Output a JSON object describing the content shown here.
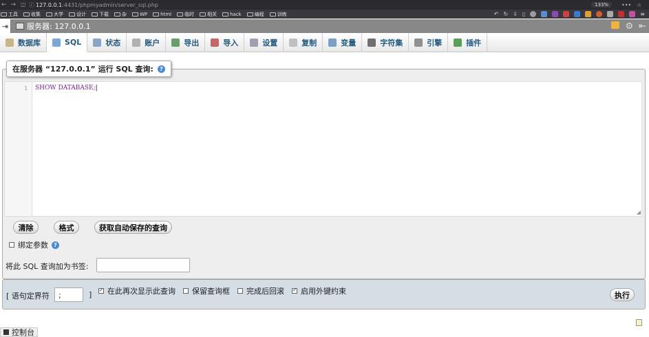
{
  "browser": {
    "url_host": "127.0.0.1",
    "url_path": ":4431/phpmyadmin/server_sql.php",
    "zoom": "133%",
    "bookmarks": [
      "工具",
      "收集",
      "大学",
      "设计",
      "下载",
      "杂",
      "WP",
      "html",
      "临时",
      "相关",
      "hack",
      "编程",
      "训练"
    ]
  },
  "breadcrumb": {
    "server": "服务器: 127.0.0.1"
  },
  "tabs": [
    {
      "label": "数据库",
      "color": "#c7b68a"
    },
    {
      "label": "SQL",
      "color": "#7aa7d6"
    },
    {
      "label": "状态",
      "color": "#8aa4c8"
    },
    {
      "label": "账户",
      "color": "#b0b0b0"
    },
    {
      "label": "导出",
      "color": "#6a9e6a"
    },
    {
      "label": "导入",
      "color": "#c06a6a"
    },
    {
      "label": "设置",
      "color": "#a0a0b0"
    },
    {
      "label": "复制",
      "color": "#c0c0c0"
    },
    {
      "label": "变量",
      "color": "#7aa0c8"
    },
    {
      "label": "字符集",
      "color": "#707070"
    },
    {
      "label": "引擎",
      "color": "#909090"
    },
    {
      "label": "插件",
      "color": "#5aa05a"
    }
  ],
  "query_panel": {
    "legend": "在服务器 “127.0.0.1” 运行 SQL 查询:",
    "line_number": "1",
    "sql": "SHOW DATABASE;"
  },
  "buttons": {
    "clear": "清除",
    "format": "格式",
    "autosave": "获取自动保存的查询",
    "go": "执行"
  },
  "bind_params": {
    "label": "绑定参数"
  },
  "bookmark": {
    "label": "将此 SQL 查询加为书签:",
    "value": ""
  },
  "footer": {
    "delimiter_label": "[ 语句定界符",
    "delimiter_value": ";",
    "delimiter_close": "]",
    "options": [
      {
        "label": "在此再次显示此查询",
        "checked": true
      },
      {
        "label": "保留查询框",
        "checked": false
      },
      {
        "label": "完成后回滚",
        "checked": false
      },
      {
        "label": "启用外键约束",
        "checked": true
      }
    ]
  },
  "console": {
    "label": "控制台"
  }
}
